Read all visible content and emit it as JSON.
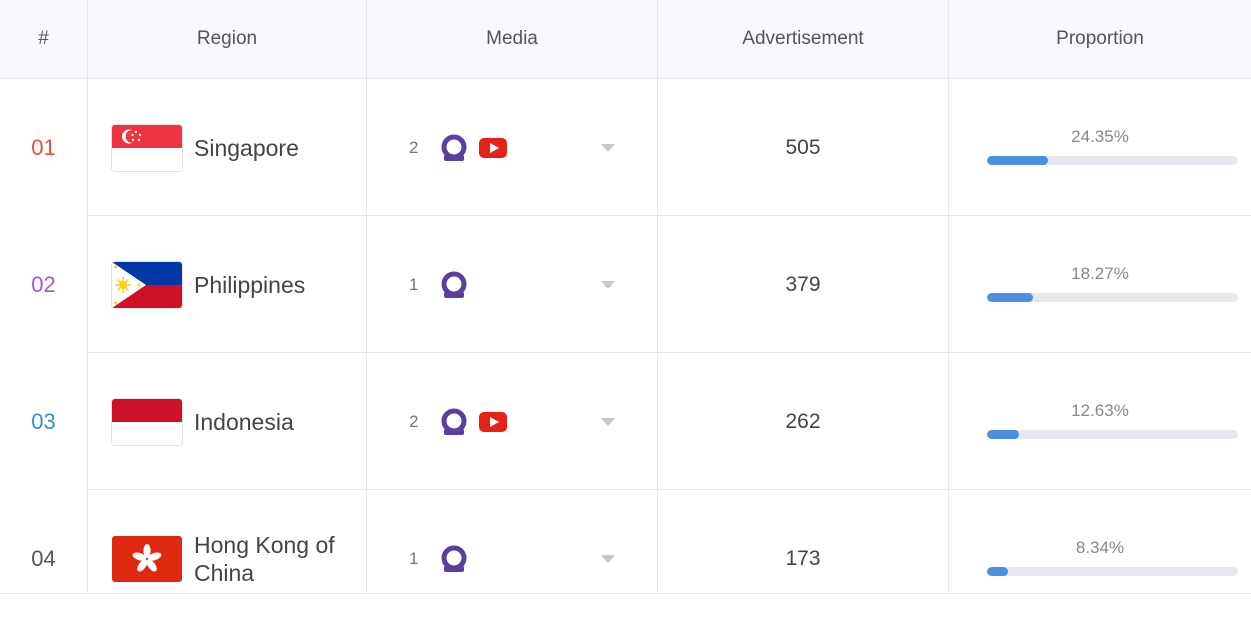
{
  "headers": {
    "rank": "#",
    "region": "Region",
    "media": "Media",
    "advertisement": "Advertisement",
    "proportion": "Proportion"
  },
  "rows": [
    {
      "rank": "01",
      "rank_color": "#f04a3a",
      "region": "Singapore",
      "flag": "singapore-flag",
      "media_count": "2",
      "media": [
        "circle-logo-icon",
        "youtube-icon"
      ],
      "ads": "505",
      "proportion": "24.35%",
      "fraction": 0.2435
    },
    {
      "rank": "02",
      "rank_color": "#9b59d6",
      "region": "Philippines",
      "flag": "philippines-flag",
      "media_count": "1",
      "media": [
        "circle-logo-icon"
      ],
      "ads": "379",
      "proportion": "18.27%",
      "fraction": 0.1827
    },
    {
      "rank": "03",
      "rank_color": "#2e8fe0",
      "region": "Indonesia",
      "flag": "indonesia-flag",
      "media_count": "2",
      "media": [
        "circle-logo-icon",
        "youtube-icon"
      ],
      "ads": "262",
      "proportion": "12.63%",
      "fraction": 0.1263
    },
    {
      "rank": "04",
      "rank_color": "#555555",
      "region": "Hong Kong of China",
      "flag": "hong-kong-flag",
      "media_count": "1",
      "media": [
        "circle-logo-icon"
      ],
      "ads": "173",
      "proportion": "8.34%",
      "fraction": 0.0834
    }
  ],
  "colors": {
    "bar_fill": "#4a90e2",
    "bar_track": "#e6e8ee",
    "header_bg": "#f8f9fc",
    "media_logo": "#5b3fa0",
    "youtube_red": "#e62117"
  }
}
